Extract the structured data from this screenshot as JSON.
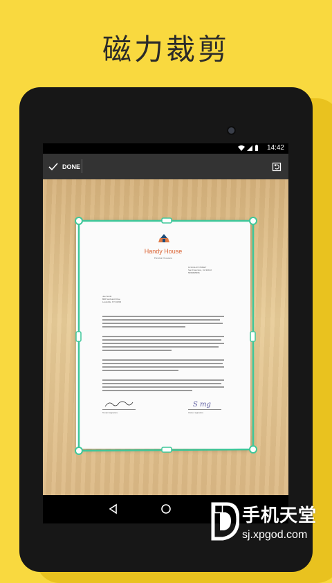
{
  "headline": "磁力裁剪",
  "status_bar": {
    "time": "14:42"
  },
  "toolbar": {
    "done_label": "DONE"
  },
  "document": {
    "company": "Handy House",
    "tagline": "Rental Houses",
    "address_lines": [
      "1234 ELM STREET",
      "San Francisco, CA 94102",
      "5555555555"
    ],
    "recipient_lines": [
      "Joe Smith",
      "882 Sunburst Drive",
      "Louisville, KY 40202"
    ],
    "signature_left_label": "Tenant signature",
    "signature_right_label": "Owner signature",
    "signature_right_text": "S mg"
  },
  "watermark": {
    "title": "手机天堂",
    "url": "sj.xpgod.com"
  },
  "colors": {
    "background": "#F9D93F",
    "crop_frame": "#3ec79a",
    "toolbar": "#333333"
  },
  "icons": {
    "done": "check-icon",
    "rotate": "rotate-icon",
    "back": "nav-back-icon",
    "home": "nav-home-icon",
    "recent": "nav-recent-icon"
  }
}
